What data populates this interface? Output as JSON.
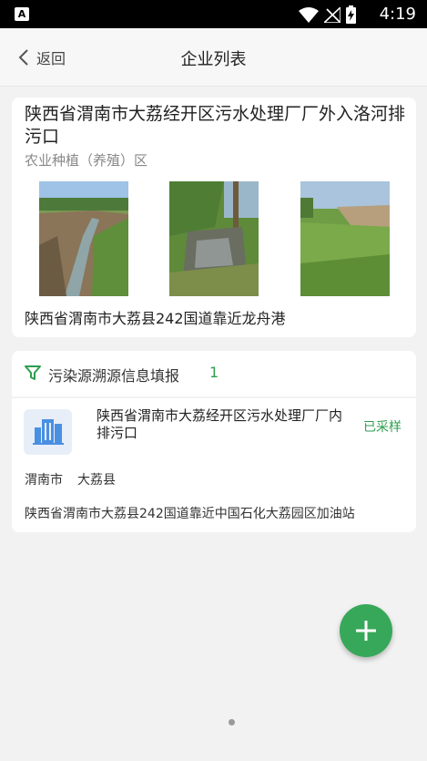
{
  "status_bar": {
    "time": "4:19",
    "icons": [
      "a-notification-icon",
      "wifi-icon",
      "no-signal-icon",
      "battery-charging-icon"
    ]
  },
  "header": {
    "back_label": "返回",
    "title": "企业列表"
  },
  "outlet_card": {
    "title": "陕西省渭南市大荔经开区污水处理厂厂外入洛河排污口",
    "type": "农业种植（养殖）区",
    "address": "陕西省渭南市大荔县242国道靠近龙舟港",
    "photos": [
      "river-bank-photo",
      "stream-with-tree-photo",
      "grassy-field-photo"
    ]
  },
  "trace_section": {
    "label": "污染源溯源信息填报",
    "count": "1"
  },
  "source_item": {
    "title": "陕西省渭南市大荔经开区污水处理厂厂内排污口",
    "status": "已采样",
    "city": "渭南市",
    "county": "大荔县",
    "address": "陕西省渭南市大荔县242国道靠近中国石化大荔园区加油站"
  },
  "colors": {
    "accent": "#37a85a",
    "status_green": "#2e9e4f",
    "building_icon": "#4a90e2"
  },
  "fab": {
    "icon": "plus-icon"
  },
  "page_indicator": {
    "count": 1
  }
}
